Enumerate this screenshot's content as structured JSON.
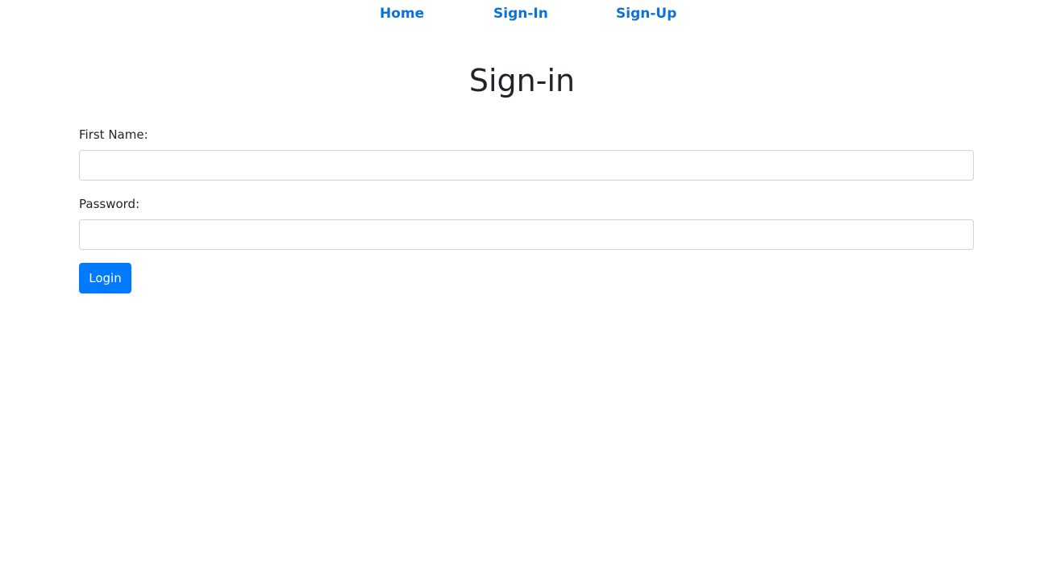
{
  "nav": {
    "items": [
      {
        "label": "Home"
      },
      {
        "label": "Sign-In"
      },
      {
        "label": "Sign-Up"
      }
    ],
    "link_color": "#0d72d6"
  },
  "page": {
    "title": "Sign-in"
  },
  "form": {
    "first_name": {
      "label": "First Name:",
      "value": "",
      "placeholder": ""
    },
    "password": {
      "label": "Password:",
      "value": "",
      "placeholder": ""
    },
    "submit_label": "Login",
    "submit_color": "#007bff"
  }
}
